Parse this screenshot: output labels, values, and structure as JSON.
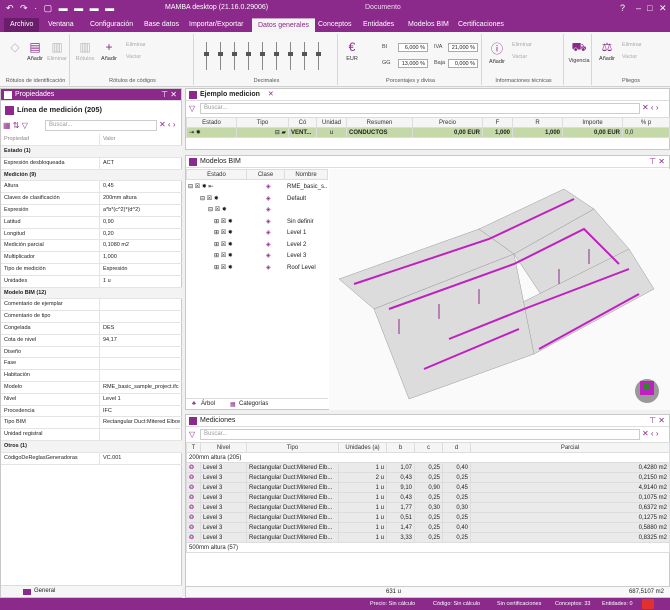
{
  "titlebar": {
    "title": "MAMBA desktop (21.16.0.29006)",
    "context": "Documento",
    "help": "?",
    "min": "–",
    "max": "□",
    "close": "✕"
  },
  "tabs": [
    "Archivo",
    "Ventana",
    "Configuración",
    "Base datos",
    "Importar/Exportar",
    "Datos generales",
    "Conceptos",
    "Entidades",
    "Modelos BIM",
    "Certificaciones"
  ],
  "active_tab": "Datos generales",
  "ribbon": {
    "g1": {
      "btn1": "Añadir",
      "btn2": "Eliminar",
      "label": "Rótulos de identificación"
    },
    "g2": {
      "btn1": "Rótulos",
      "btn2": "Añadir",
      "btn3": "Eliminar",
      "btn4": "Vaciar",
      "label": "Rótulos de códigos"
    },
    "g3": {
      "label": "Decimales"
    },
    "g4": {
      "currency": "EUR",
      "bi": "BI",
      "bi_val": "6,000 %",
      "iva": "IVA",
      "iva_val": "21,000 %",
      "gg": "GG",
      "gg_val": "13,000 %",
      "baja": "Baja",
      "baja_val": "0,000 %",
      "label": "Porcentajes y divisa"
    },
    "g5": {
      "btn1": "Añadir",
      "btn2": "Eliminar",
      "btn3": "Vaciar",
      "label": "Informaciones técnicas"
    },
    "g6": {
      "btn1": "Vigencia",
      "label": ""
    },
    "g7": {
      "btn1": "Añadir",
      "btn2": "Eliminar",
      "btn3": "Vaciar",
      "label": "Pliegos"
    }
  },
  "props": {
    "title": "Propiedades",
    "subtitle": "Línea de medición (205)",
    "search": "Buscar...",
    "col_prop": "Propiedad",
    "col_val": "Valor",
    "rows": [
      {
        "k": "Estado (1)",
        "v": "",
        "sec": true
      },
      {
        "k": "Expresión desbloqueada",
        "v": "ACT"
      },
      {
        "k": "Medición (9)",
        "v": "",
        "sec": true
      },
      {
        "k": "Altura",
        "v": "0,45"
      },
      {
        "k": "Claves de clasificación",
        "v": "200mm altura"
      },
      {
        "k": "Expresión",
        "v": "a*b*(c^2)*(d^2)"
      },
      {
        "k": "Latitud",
        "v": "0,90"
      },
      {
        "k": "Longitud",
        "v": "0,20"
      },
      {
        "k": "Medición parcial",
        "v": "0,1080 m2"
      },
      {
        "k": "Multiplicador",
        "v": "1,000"
      },
      {
        "k": "Tipo de medición",
        "v": "Expresión"
      },
      {
        "k": "Unidades",
        "v": "1 u"
      },
      {
        "k": "Modelo BIM (12)",
        "v": "",
        "sec": true
      },
      {
        "k": "Comentario de ejemplar",
        "v": ""
      },
      {
        "k": "Comentario de tipo",
        "v": ""
      },
      {
        "k": "Congelada",
        "v": "DES"
      },
      {
        "k": "Cota de nivel",
        "v": "94,17"
      },
      {
        "k": "Diseño",
        "v": ""
      },
      {
        "k": "Fase",
        "v": ""
      },
      {
        "k": "Habitación",
        "v": ""
      },
      {
        "k": "Modelo",
        "v": "RME_basic_sample_project.ifc"
      },
      {
        "k": "Nivel",
        "v": "Level 1"
      },
      {
        "k": "Procedencia",
        "v": "IFC"
      },
      {
        "k": "Tipo BIM",
        "v": "Rectangular Duct:Mitered Elbows"
      },
      {
        "k": "Unidad registral",
        "v": ""
      },
      {
        "k": "Otros (1)",
        "v": "",
        "sec": true
      },
      {
        "k": "CódigoDeReglasGeneradoras",
        "v": "VC.001"
      }
    ],
    "footer": "General"
  },
  "main": {
    "tab": "Ejemplo medicion",
    "search": "Buscar...",
    "headers": [
      "Estado",
      "Tipo",
      "Có",
      "Unidad",
      "Resumen",
      "Precio",
      "F",
      "R",
      "Importe",
      "% p"
    ],
    "row": {
      "code": "VENT...",
      "unit": "u",
      "resumen": "CONDUCTOS",
      "precio": "0,00 EUR",
      "f": "1,000",
      "r": "1,000",
      "importe": "0,00 EUR",
      "pct": "0,0"
    }
  },
  "bim": {
    "title": "Modelos BIM",
    "headers": [
      "Estado",
      "Clase",
      "Nombre"
    ],
    "rows": [
      {
        "name": "RME_basic_s..."
      },
      {
        "name": "Default"
      },
      {
        "name": ""
      },
      {
        "name": "Sin definir"
      },
      {
        "name": "Level 1"
      },
      {
        "name": "Level 2"
      },
      {
        "name": "Level 3"
      },
      {
        "name": "Roof Level"
      }
    ],
    "tab1": "Árbol",
    "tab2": "Categorías"
  },
  "med": {
    "title": "Mediciones",
    "search": "Buscar...",
    "headers": [
      "T",
      "Nivel",
      "Tipo",
      "Unidades (a)",
      "b",
      "c",
      "d",
      "Parcial"
    ],
    "group1": "200mm altura (205)",
    "rows": [
      {
        "nivel": "Level 3",
        "tipo": "Rectangular Duct:Mitered Elb...",
        "u": "1 u",
        "b": "1,07",
        "c": "0,25",
        "d": "0,40",
        "p": "0,4280 m2"
      },
      {
        "nivel": "Level 3",
        "tipo": "Rectangular Duct:Mitered Elb...",
        "u": "2 u",
        "b": "0,43",
        "c": "0,25",
        "d": "0,25",
        "p": "0,2150 m2"
      },
      {
        "nivel": "Level 3",
        "tipo": "Rectangular Duct:Mitered Elb...",
        "u": "1 u",
        "b": "9,10",
        "c": "0,90",
        "d": "0,45",
        "p": "4,9140 m2"
      },
      {
        "nivel": "Level 3",
        "tipo": "Rectangular Duct:Mitered Elb...",
        "u": "1 u",
        "b": "0,43",
        "c": "0,25",
        "d": "0,25",
        "p": "0,1075 m2"
      },
      {
        "nivel": "Level 3",
        "tipo": "Rectangular Duct:Mitered Elb...",
        "u": "1 u",
        "b": "1,77",
        "c": "0,30",
        "d": "0,30",
        "p": "0,6372 m2"
      },
      {
        "nivel": "Level 3",
        "tipo": "Rectangular Duct:Mitered Elb...",
        "u": "1 u",
        "b": "0,51",
        "c": "0,25",
        "d": "0,25",
        "p": "0,1275 m2"
      },
      {
        "nivel": "Level 3",
        "tipo": "Rectangular Duct:Mitered Elb...",
        "u": "1 u",
        "b": "1,47",
        "c": "0,25",
        "d": "0,40",
        "p": "0,5880 m2"
      },
      {
        "nivel": "Level 3",
        "tipo": "Rectangular Duct:Mitered Elb...",
        "u": "1 u",
        "b": "3,33",
        "c": "0,25",
        "d": "0,25",
        "p": "0,8325 m2"
      }
    ],
    "group2": "500mm altura (57)",
    "total_u": "631 u",
    "total_p": "687,5107 m2"
  },
  "status": {
    "precio": "Precio: Sin cálculo",
    "codigo": "Código: Sin cálculo",
    "cert": "Sin certificaciones",
    "conceptos": "Conceptos: 33",
    "entidades": "Entidades: 0"
  },
  "colors": {
    "accent": "#8b2a8b",
    "rowsel": "#c5d9a8"
  }
}
